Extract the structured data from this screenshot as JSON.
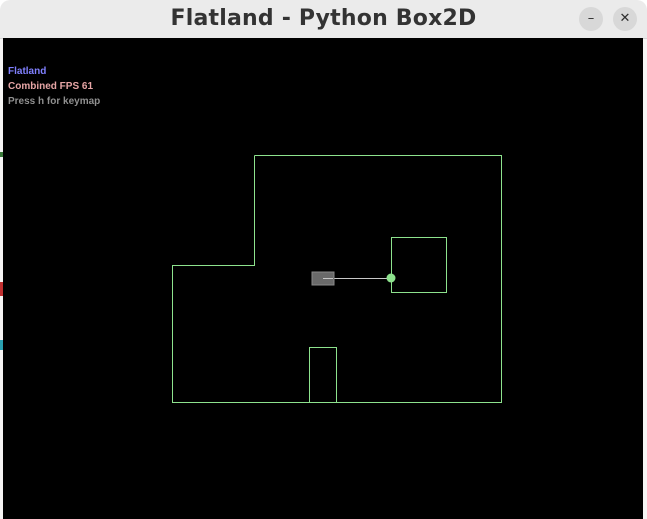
{
  "window": {
    "title": "Flatland - Python Box2D",
    "minimize_symbol": "–",
    "close_symbol": "✕"
  },
  "hud": {
    "app_name": "Flatland",
    "fps_text": "Combined FPS 61",
    "help_text": "Press h for keymap"
  },
  "colors": {
    "wall": "#8de28d",
    "agent_body": "#6a6a6a",
    "sensor_line": "#c8c8c8",
    "target": "#8de28d",
    "app_name": "#8080ff",
    "fps": "#e6a5a5",
    "help": "#909090",
    "background": "#000000"
  }
}
